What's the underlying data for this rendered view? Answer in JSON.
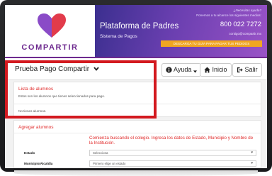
{
  "brand": {
    "logo_text": "COMPARTIR",
    "heart_colors": {
      "left": "#8a4bc7",
      "right": "#e23b4b"
    }
  },
  "banner": {
    "title": "Plataforma de Padres",
    "subtitle": "Sistema de Pagos",
    "help_line1": "¿Necesitas ayuda?",
    "help_line2": "Ponemos a tu alcance los siguientes medios:",
    "phone": "800 022 7272",
    "email": "contigo@compartir.mx",
    "cta": "DESCARGA TU GUÍA PARA PAGAR TUS PEDIDOS"
  },
  "toolbar": {
    "dropdown_label": "Prueba Pago Compartir",
    "help_label": "Ayuda",
    "home_label": "Inicio",
    "exit_label": "Salir"
  },
  "students_list": {
    "title": "Lista de alumnos",
    "description": "Estos son los alumnos que tienes seleccionados para pago.",
    "empty_message": "No tienes alumnos."
  },
  "add_students": {
    "title": "Agregar alumnos",
    "instruction": "Comienza buscando el colegio. Ingresa los datos de Estado, Municipio y Nombre de la Institución.",
    "state_label": "Estado",
    "state_value": "Selecciona",
    "municipality_label": "Municipio/Alcaldía",
    "municipality_value": "Primero elige un estado"
  },
  "colors": {
    "accent_red": "#e02b2b",
    "highlight_red": "#d3191f",
    "brand_purple": "#6e2a8f",
    "cta_orange": "#f0a622"
  }
}
